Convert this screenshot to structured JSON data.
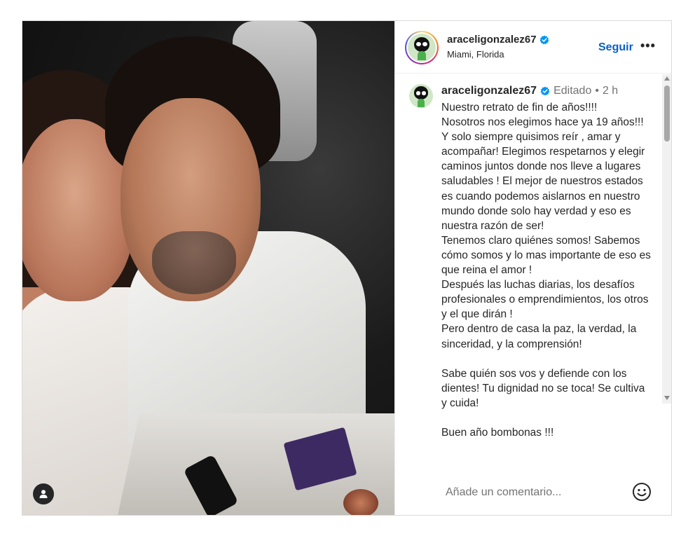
{
  "post": {
    "username": "araceligonzalez67",
    "location": "Miami, Florida",
    "follow_label": "Seguir",
    "more_label": "•••",
    "edited_label": "Editado",
    "separator": "•",
    "time_ago": "2 h",
    "caption": "Nuestro retrato de fin de años!!!!\nNosotros nos elegimos hace ya 19 años!!! Y solo siempre quisimos reír , amar y acompañar! Elegimos respetarnos y elegir caminos juntos donde nos lleve a lugares saludables ! El mejor de nuestros estados es cuando podemos aislarnos en nuestro mundo donde solo hay verdad y eso es nuestra razón de ser!\nTenemos claro quiénes somos! Sabemos cómo somos y lo mas importante de eso es que reina el amor !\nDespués las luchas diarias, los desafíos profesionales o emprendimientos, los otros y el que dirán !\nPero dentro de casa la paz, la verdad, la sinceridad, y la comprensión!\n\nSabe quién sos vos y defiende con los dientes! Tu dignidad no se toca! Se cultiva y cuida!\n\nBuen año bombonas !!!"
  },
  "comment": {
    "placeholder": "Añade un comentario..."
  },
  "icons": {
    "verified": "verified-badge-icon",
    "emoji": "smiley-icon",
    "tag": "user-tag-icon"
  },
  "colors": {
    "follow": "#0a5fc7",
    "verified": "#0095f6",
    "text": "#262626",
    "muted": "#737373"
  }
}
